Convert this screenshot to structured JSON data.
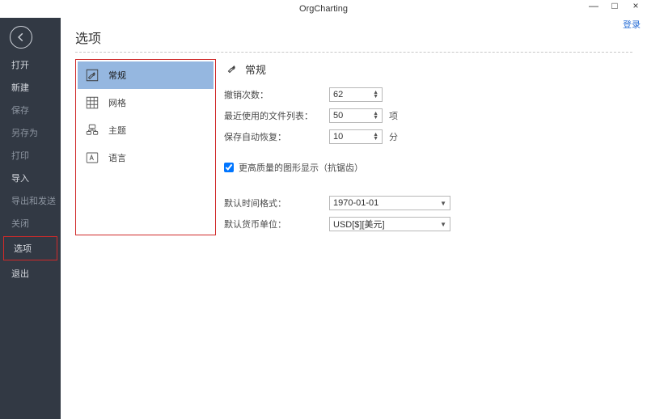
{
  "app": {
    "title": "OrgCharting",
    "login": "登录"
  },
  "window_controls": {
    "min": "—",
    "max": "□",
    "close": "×"
  },
  "sidebar": {
    "items": [
      {
        "label": "打开"
      },
      {
        "label": "新建"
      },
      {
        "label": "保存"
      },
      {
        "label": "另存为"
      },
      {
        "label": "打印"
      },
      {
        "label": "导入"
      },
      {
        "label": "导出和发送"
      },
      {
        "label": "关闭"
      },
      {
        "label": "选项"
      },
      {
        "label": "退出"
      }
    ]
  },
  "page": {
    "title": "选项"
  },
  "categories": [
    {
      "key": "general",
      "label": "常规"
    },
    {
      "key": "grid",
      "label": "网格"
    },
    {
      "key": "theme",
      "label": "主题"
    },
    {
      "key": "language",
      "label": "语言"
    }
  ],
  "settings": {
    "section_title": "常规",
    "undo_label": "撤销次数：",
    "undo_value": "62",
    "recent_label": "最近使用的文件列表：",
    "recent_value": "50",
    "recent_unit": "项",
    "autosave_label": "保存自动恢复：",
    "autosave_value": "10",
    "autosave_unit": "分",
    "antialias_label": "更高质量的图形显示（抗锯齿）",
    "antialias_checked": true,
    "dateformat_label": "默认时间格式：",
    "dateformat_value": "1970-01-01",
    "currency_label": "默认货币单位：",
    "currency_value": "USD[$][美元]"
  }
}
